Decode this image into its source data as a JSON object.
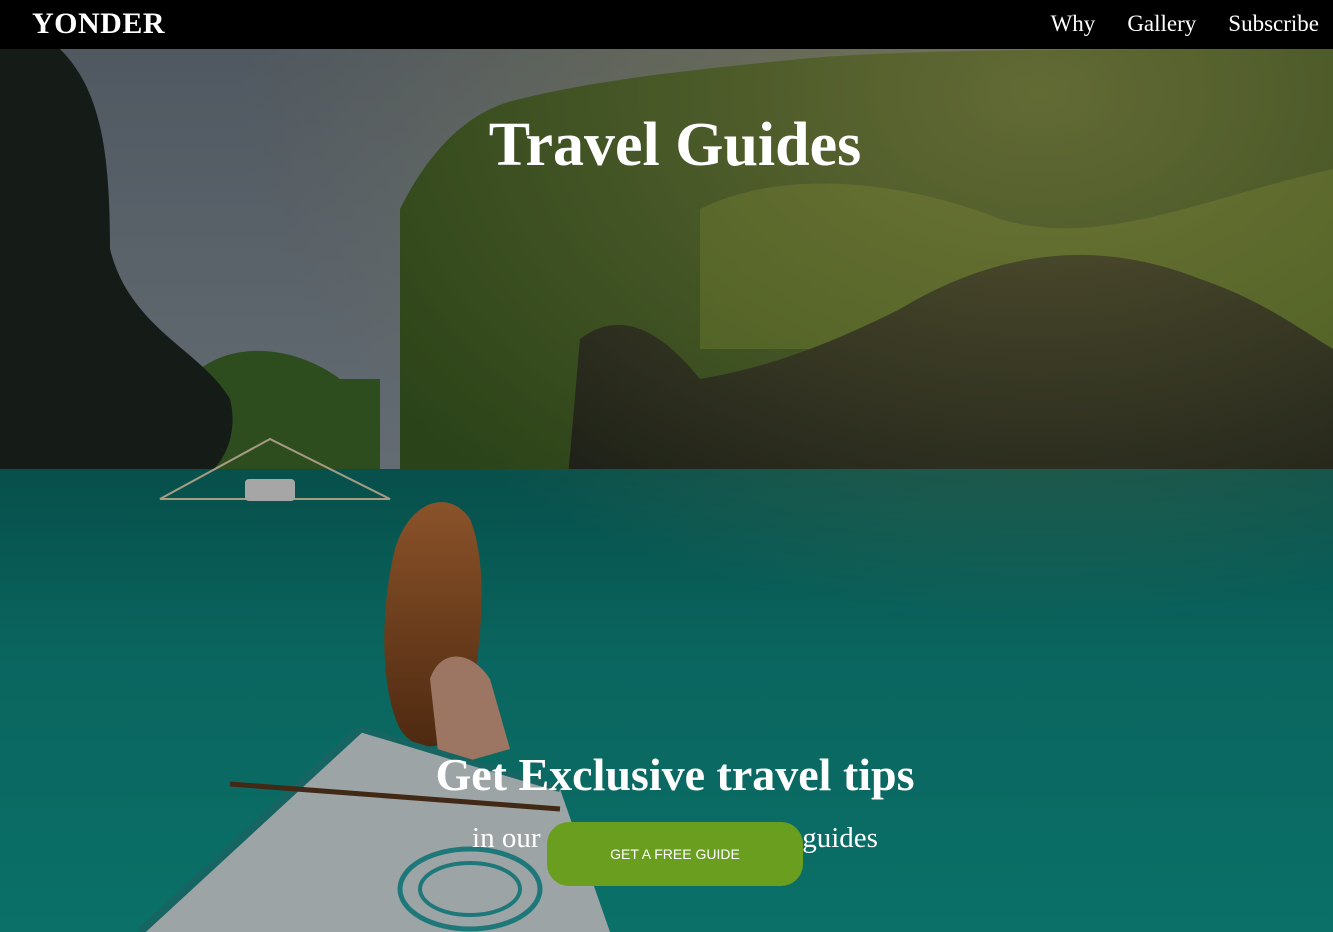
{
  "nav": {
    "brand": "YONDER",
    "links": [
      {
        "label": "Why"
      },
      {
        "label": "Gallery"
      },
      {
        "label": "Subscribe"
      }
    ]
  },
  "hero": {
    "title": "Travel Guides",
    "tagline": "Get Exclusive travel tips",
    "subtagline": "in our destination specific e-guides",
    "cta_label": "GET A FREE GUIDE"
  },
  "colors": {
    "navbar_bg": "#000000",
    "cta_bg": "#6a9e1f",
    "text": "#ffffff"
  }
}
